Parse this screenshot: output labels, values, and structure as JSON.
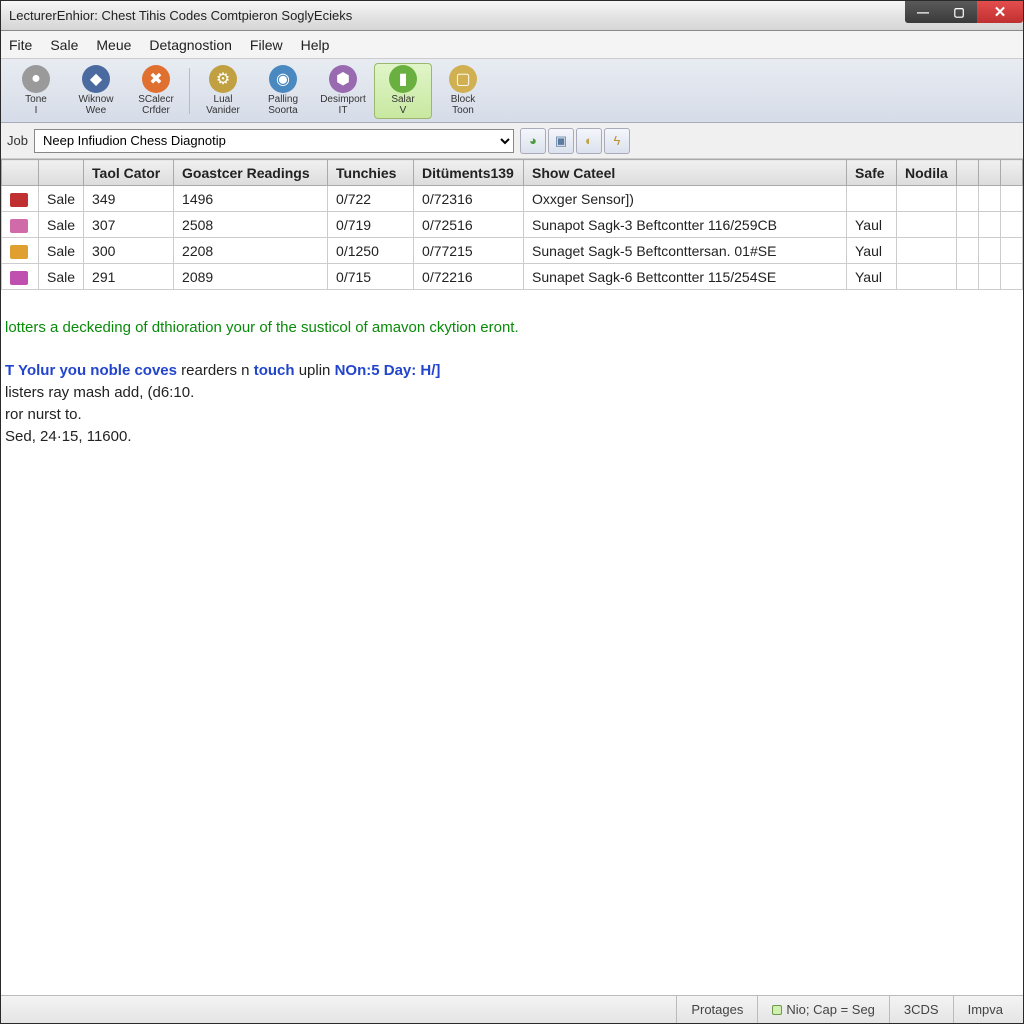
{
  "titlebar": {
    "text": "LecturerEnhior: Chest Tihis Codes Comtpieron SoglyEcieks"
  },
  "menu": {
    "items": [
      "Fite",
      "Sale",
      "Meue",
      "Detagnostion",
      "Filew",
      "Help"
    ]
  },
  "toolbar": {
    "items": [
      {
        "label": "Tone\nI",
        "color": "#9a9a9a",
        "glyph": "●"
      },
      {
        "label": "Wiknow\nWee",
        "color": "#4a6aa0",
        "glyph": "◆"
      },
      {
        "label": "SCalecr\nCrfder",
        "color": "#e07030",
        "glyph": "✖"
      },
      {
        "label": "Lual\nVanider",
        "color": "#c0a040",
        "glyph": "⚙"
      },
      {
        "label": "Palling\nSoorta",
        "color": "#4a88c0",
        "glyph": "◉"
      },
      {
        "label": "Desimport\nIT",
        "color": "#9a6ab0",
        "glyph": "⬢"
      },
      {
        "label": "Salar\nV",
        "color": "#6ab040",
        "glyph": "▮",
        "active": true
      },
      {
        "label": "Block\nToon",
        "color": "#d0b050",
        "glyph": "▢"
      }
    ]
  },
  "jobbar": {
    "label": "Job",
    "selected": "Neep Infiudion Chess Diagnotip",
    "icons": [
      "leaf-icon",
      "layers-icon",
      "filter-icon",
      "bolt-icon"
    ]
  },
  "table": {
    "headers": [
      "",
      "",
      "Taol Cator",
      "Goastcer Readings",
      "Tunchies",
      "Ditüments139",
      "Show Cateel",
      "Safe",
      "Nodila",
      "",
      "",
      ""
    ],
    "rows": [
      {
        "icon_color": "#c03030",
        "sale": "Sale",
        "c0": "349",
        "c1": "1496",
        "c2": "0/722",
        "c3": "0/72316",
        "c4": "Oxxger Sensor])",
        "c5": "",
        "c6": ""
      },
      {
        "icon_color": "#d06aa8",
        "sale": "Sale",
        "c0": "307",
        "c1": "2508",
        "c2": "0/719",
        "c3": "0/72516",
        "c4": "Sunapot Sagk-3 Beftcontter 116/259CB",
        "c5": "Yaul",
        "c6": ""
      },
      {
        "icon_color": "#e0a030",
        "sale": "Sale",
        "c0": "300",
        "c1": "2208",
        "c2": "0/1250",
        "c3": "0/77215",
        "c4": "Sunaget Sagk-5 Beftconttersan. 01#SE",
        "c5": "Yaul",
        "c6": ""
      },
      {
        "icon_color": "#c050b0",
        "sale": "Sale",
        "c0": "291",
        "c1": "2089",
        "c2": "0/715",
        "c3": "0/72216",
        "c4": "Sunapet Sagk-6 Bettcontter 115/254SE",
        "c5": "Yaul",
        "c6": ""
      }
    ]
  },
  "console": {
    "line1": "lotters a deckeding of dthioration your of the susticol of amavon ckytion eront.",
    "line2_a": "T Yolur you noble coves ",
    "line2_b": "rearders n ",
    "line2_c": "touch ",
    "line2_d": "uplin ",
    "line2_e": "NOn:5 Day: H/]",
    "line3": "listers ray mash add, (d6:10.",
    "line4": "ror nurst to.",
    "line5": "Sed, 24·15, 11600."
  },
  "statusbar": {
    "cells": [
      "Protages",
      "Nio; Cap = Seg",
      "3CDS",
      "Impva"
    ]
  }
}
